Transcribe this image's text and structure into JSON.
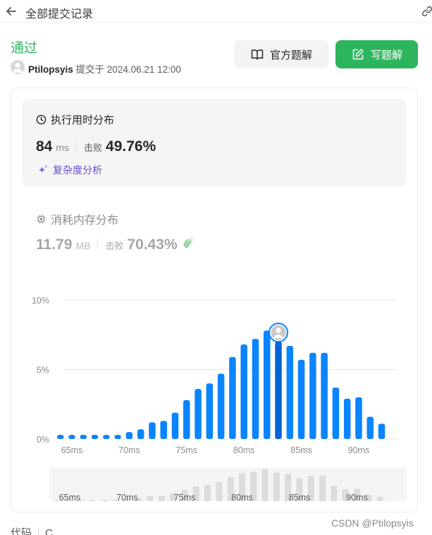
{
  "header": {
    "back_icon": "arrow-left-icon",
    "title": "全部提交记录",
    "link_icon": "link-icon"
  },
  "submission": {
    "status": "通过",
    "author": "Ptilopsyis",
    "submitted_text": "提交于 2024.06.21 12:00"
  },
  "actions": {
    "official_solution": "官方题解",
    "write_solution": "写题解"
  },
  "runtime": {
    "title": "执行用时分布",
    "value": "84",
    "unit": "ms",
    "beat_label": "击败",
    "beat_percent": "49.76%",
    "complexity_label": "复杂度分析"
  },
  "memory": {
    "title": "消耗内存分布",
    "value": "11.79",
    "unit": "MB",
    "beat_label": "击败",
    "beat_percent": "70.43%"
  },
  "colors": {
    "accent_green": "#2db55d",
    "bar_blue": "#0a84ff",
    "bar_highlight": "#0062d6",
    "overview_bar": "#dcdcdc",
    "purple": "#6a4bd8"
  },
  "chart_data": {
    "type": "bar",
    "title": "",
    "xlabel": "",
    "ylabel": "",
    "ylim": [
      0,
      10
    ],
    "y_ticks": [
      "0%",
      "5%",
      "10%"
    ],
    "x_ticks": [
      "65ms",
      "70ms",
      "75ms",
      "80ms",
      "85ms",
      "90ms"
    ],
    "x": [
      64,
      65,
      66,
      67,
      68,
      69,
      70,
      71,
      72,
      73,
      74,
      75,
      76,
      77,
      78,
      79,
      80,
      81,
      82,
      83,
      84,
      85,
      86,
      87,
      88,
      89,
      90,
      91,
      92,
      93
    ],
    "values": [
      0.3,
      0.3,
      0.3,
      0.3,
      0.3,
      0.3,
      0.5,
      0.7,
      1.2,
      1.3,
      1.9,
      2.8,
      3.6,
      4.0,
      4.7,
      5.9,
      6.8,
      7.2,
      7.8,
      7.0,
      6.7,
      5.7,
      6.2,
      6.2,
      3.7,
      2.9,
      3.0,
      1.6,
      1.1,
      0.0
    ],
    "highlight_x": 83,
    "grid": true,
    "overview": {
      "x_ticks": [
        "65ms",
        "70ms",
        "75ms",
        "80ms",
        "85ms",
        "90ms"
      ]
    }
  },
  "bottom": {
    "code_label": "代码",
    "lang_label": "C"
  },
  "watermark": "CSDN @Ptilopsyis"
}
